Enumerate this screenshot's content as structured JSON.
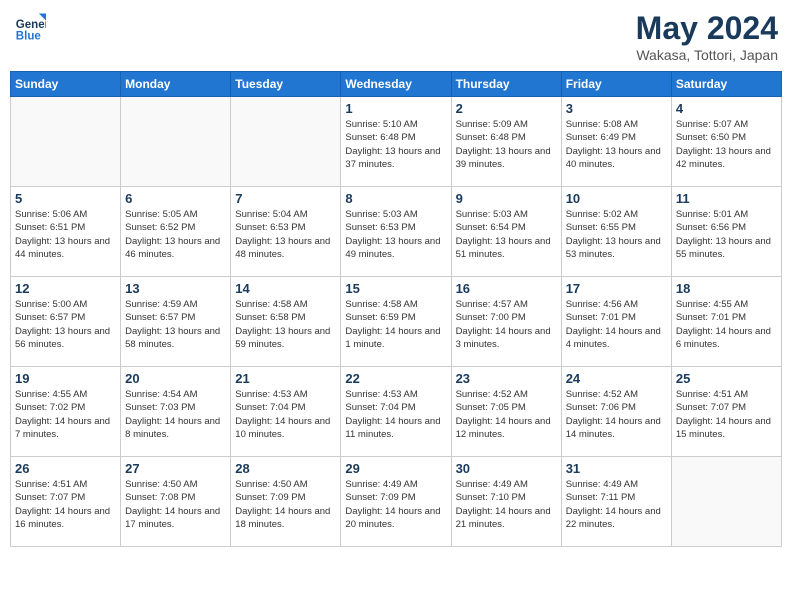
{
  "header": {
    "logo_line1": "General",
    "logo_line2": "Blue",
    "month": "May 2024",
    "location": "Wakasa, Tottori, Japan"
  },
  "weekdays": [
    "Sunday",
    "Monday",
    "Tuesday",
    "Wednesday",
    "Thursday",
    "Friday",
    "Saturday"
  ],
  "weeks": [
    [
      {
        "day": "",
        "info": ""
      },
      {
        "day": "",
        "info": ""
      },
      {
        "day": "",
        "info": ""
      },
      {
        "day": "1",
        "info": "Sunrise: 5:10 AM\nSunset: 6:48 PM\nDaylight: 13 hours and 37 minutes."
      },
      {
        "day": "2",
        "info": "Sunrise: 5:09 AM\nSunset: 6:48 PM\nDaylight: 13 hours and 39 minutes."
      },
      {
        "day": "3",
        "info": "Sunrise: 5:08 AM\nSunset: 6:49 PM\nDaylight: 13 hours and 40 minutes."
      },
      {
        "day": "4",
        "info": "Sunrise: 5:07 AM\nSunset: 6:50 PM\nDaylight: 13 hours and 42 minutes."
      }
    ],
    [
      {
        "day": "5",
        "info": "Sunrise: 5:06 AM\nSunset: 6:51 PM\nDaylight: 13 hours and 44 minutes."
      },
      {
        "day": "6",
        "info": "Sunrise: 5:05 AM\nSunset: 6:52 PM\nDaylight: 13 hours and 46 minutes."
      },
      {
        "day": "7",
        "info": "Sunrise: 5:04 AM\nSunset: 6:53 PM\nDaylight: 13 hours and 48 minutes."
      },
      {
        "day": "8",
        "info": "Sunrise: 5:03 AM\nSunset: 6:53 PM\nDaylight: 13 hours and 49 minutes."
      },
      {
        "day": "9",
        "info": "Sunrise: 5:03 AM\nSunset: 6:54 PM\nDaylight: 13 hours and 51 minutes."
      },
      {
        "day": "10",
        "info": "Sunrise: 5:02 AM\nSunset: 6:55 PM\nDaylight: 13 hours and 53 minutes."
      },
      {
        "day": "11",
        "info": "Sunrise: 5:01 AM\nSunset: 6:56 PM\nDaylight: 13 hours and 55 minutes."
      }
    ],
    [
      {
        "day": "12",
        "info": "Sunrise: 5:00 AM\nSunset: 6:57 PM\nDaylight: 13 hours and 56 minutes."
      },
      {
        "day": "13",
        "info": "Sunrise: 4:59 AM\nSunset: 6:57 PM\nDaylight: 13 hours and 58 minutes."
      },
      {
        "day": "14",
        "info": "Sunrise: 4:58 AM\nSunset: 6:58 PM\nDaylight: 13 hours and 59 minutes."
      },
      {
        "day": "15",
        "info": "Sunrise: 4:58 AM\nSunset: 6:59 PM\nDaylight: 14 hours and 1 minute."
      },
      {
        "day": "16",
        "info": "Sunrise: 4:57 AM\nSunset: 7:00 PM\nDaylight: 14 hours and 3 minutes."
      },
      {
        "day": "17",
        "info": "Sunrise: 4:56 AM\nSunset: 7:01 PM\nDaylight: 14 hours and 4 minutes."
      },
      {
        "day": "18",
        "info": "Sunrise: 4:55 AM\nSunset: 7:01 PM\nDaylight: 14 hours and 6 minutes."
      }
    ],
    [
      {
        "day": "19",
        "info": "Sunrise: 4:55 AM\nSunset: 7:02 PM\nDaylight: 14 hours and 7 minutes."
      },
      {
        "day": "20",
        "info": "Sunrise: 4:54 AM\nSunset: 7:03 PM\nDaylight: 14 hours and 8 minutes."
      },
      {
        "day": "21",
        "info": "Sunrise: 4:53 AM\nSunset: 7:04 PM\nDaylight: 14 hours and 10 minutes."
      },
      {
        "day": "22",
        "info": "Sunrise: 4:53 AM\nSunset: 7:04 PM\nDaylight: 14 hours and 11 minutes."
      },
      {
        "day": "23",
        "info": "Sunrise: 4:52 AM\nSunset: 7:05 PM\nDaylight: 14 hours and 12 minutes."
      },
      {
        "day": "24",
        "info": "Sunrise: 4:52 AM\nSunset: 7:06 PM\nDaylight: 14 hours and 14 minutes."
      },
      {
        "day": "25",
        "info": "Sunrise: 4:51 AM\nSunset: 7:07 PM\nDaylight: 14 hours and 15 minutes."
      }
    ],
    [
      {
        "day": "26",
        "info": "Sunrise: 4:51 AM\nSunset: 7:07 PM\nDaylight: 14 hours and 16 minutes."
      },
      {
        "day": "27",
        "info": "Sunrise: 4:50 AM\nSunset: 7:08 PM\nDaylight: 14 hours and 17 minutes."
      },
      {
        "day": "28",
        "info": "Sunrise: 4:50 AM\nSunset: 7:09 PM\nDaylight: 14 hours and 18 minutes."
      },
      {
        "day": "29",
        "info": "Sunrise: 4:49 AM\nSunset: 7:09 PM\nDaylight: 14 hours and 20 minutes."
      },
      {
        "day": "30",
        "info": "Sunrise: 4:49 AM\nSunset: 7:10 PM\nDaylight: 14 hours and 21 minutes."
      },
      {
        "day": "31",
        "info": "Sunrise: 4:49 AM\nSunset: 7:11 PM\nDaylight: 14 hours and 22 minutes."
      },
      {
        "day": "",
        "info": ""
      }
    ]
  ]
}
